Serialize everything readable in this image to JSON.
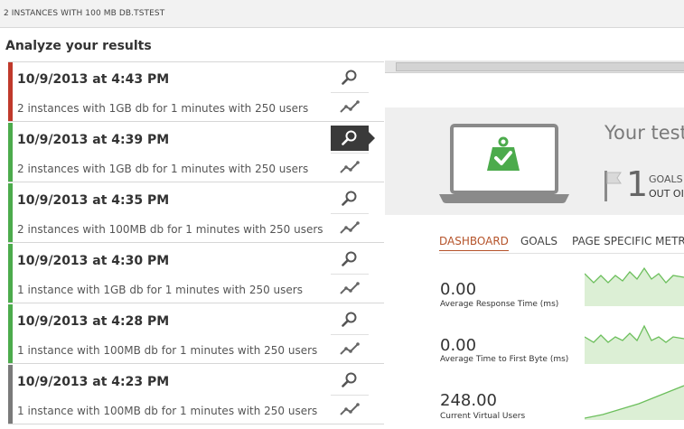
{
  "window": {
    "title": "2 INSTANCES WITH 100 MB DB.TSTEST"
  },
  "heading": "Analyze your results",
  "colors": {
    "red": "#c0392b",
    "green": "#4cab4c",
    "gray": "#7a7a7a",
    "accent": "#b5532a",
    "chart_fill": "#dcefd5",
    "chart_line": "#6cbf5c"
  },
  "results": [
    {
      "title": "10/9/2013 at 4:43 PM",
      "description": "2 instances with 1GB db for 1 minutes with 250 users",
      "status": "red",
      "selected": false
    },
    {
      "title": "10/9/2013 at 4:39 PM",
      "description": "2 instances with 1GB db for 1 minutes with 250 users",
      "status": "green",
      "selected": true
    },
    {
      "title": "10/9/2013 at 4:35 PM",
      "description": "2 instances with 100MB db for 1 minutes with 250 users",
      "status": "green",
      "selected": false
    },
    {
      "title": "10/9/2013 at 4:30 PM",
      "description": "1 instance with 1GB db for 1 minutes with 250 users",
      "status": "green",
      "selected": false
    },
    {
      "title": "10/9/2013 at 4:28 PM",
      "description": "1 instance with 100MB db for 1 minutes with 250 users",
      "status": "green",
      "selected": false
    },
    {
      "title": "10/9/2013 at 4:23 PM",
      "description": "1 instance with 100MB db for 1 minutes with 250 users",
      "status": "gray",
      "selected": false
    }
  ],
  "summary": {
    "title": "Your test",
    "goals_count": "1",
    "goals_label": "GOALS",
    "goals_sub": "OUT OI"
  },
  "tabs": [
    {
      "label": "DASHBOARD",
      "active": true
    },
    {
      "label": "GOALS",
      "active": false
    },
    {
      "label": "PAGE SPECIFIC METRIC",
      "active": false
    }
  ],
  "metrics": [
    {
      "value": "0.00",
      "label": "Average Response Time (ms)"
    },
    {
      "value": "0.00",
      "label": "Average Time to First Byte (ms)"
    },
    {
      "value": "248.00",
      "label": "Current Virtual Users"
    }
  ],
  "icons": {
    "magnifier": "magnifier-icon",
    "trend": "trend-icon",
    "laptop": "laptop-icon",
    "weight_check": "weight-check-icon",
    "flag": "flag-icon"
  }
}
